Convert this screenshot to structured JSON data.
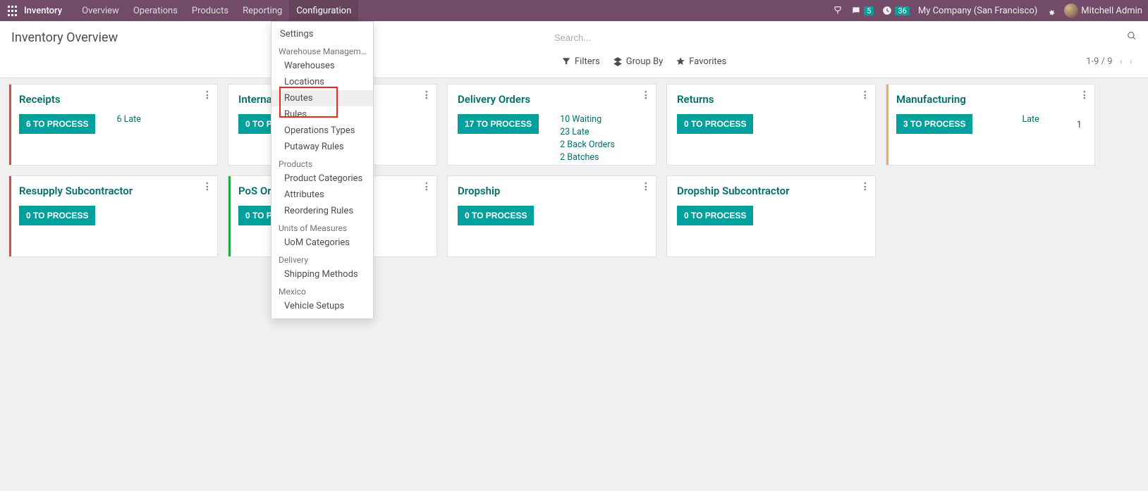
{
  "topbar": {
    "brand": "Inventory",
    "menu": [
      "Overview",
      "Operations",
      "Products",
      "Reporting",
      "Configuration"
    ],
    "active_menu_index": 4,
    "messages_badge": "5",
    "activities_badge": "36",
    "company": "My Company (San Francisco)",
    "user": "Mitchell Admin"
  },
  "control_panel": {
    "title": "Inventory Overview",
    "search_placeholder": "Search...",
    "filters_label": "Filters",
    "groupby_label": "Group By",
    "favorites_label": "Favorites",
    "pager_text": "1-9 / 9"
  },
  "dropdown": {
    "items": [
      {
        "type": "item",
        "label": "Settings"
      },
      {
        "type": "header",
        "label": "Warehouse Management"
      },
      {
        "type": "item",
        "label": "Warehouses",
        "indent": true
      },
      {
        "type": "item",
        "label": "Locations",
        "indent": true
      },
      {
        "type": "item",
        "label": "Routes",
        "indent": true,
        "hover": true
      },
      {
        "type": "item",
        "label": "Rules",
        "indent": true
      },
      {
        "type": "item",
        "label": "Operations Types",
        "indent": true
      },
      {
        "type": "item",
        "label": "Putaway Rules",
        "indent": true
      },
      {
        "type": "header",
        "label": "Products"
      },
      {
        "type": "item",
        "label": "Product Categories",
        "indent": true
      },
      {
        "type": "item",
        "label": "Attributes",
        "indent": true
      },
      {
        "type": "item",
        "label": "Reordering Rules",
        "indent": true
      },
      {
        "type": "header",
        "label": "Units of Measures"
      },
      {
        "type": "item",
        "label": "UoM Categories",
        "indent": true
      },
      {
        "type": "header",
        "label": "Delivery"
      },
      {
        "type": "item",
        "label": "Shipping Methods",
        "indent": true
      },
      {
        "type": "header",
        "label": "Mexico"
      },
      {
        "type": "item",
        "label": "Vehicle Setups",
        "indent": true
      }
    ]
  },
  "cards": [
    {
      "title": "Receipts",
      "button": "6 TO PROCESS",
      "stats": [
        {
          "label": "6 Late"
        }
      ],
      "stripe": "#e24943"
    },
    {
      "title": "Internal Transfers",
      "button": "0 TO PROCESS",
      "stats": [],
      "stripe": ""
    },
    {
      "title": "Delivery Orders",
      "button": "17 TO PROCESS",
      "stats": [
        {
          "label": "10 Waiting"
        },
        {
          "label": "23 Late"
        },
        {
          "label": "2 Back Orders"
        },
        {
          "label": "2 Batches"
        }
      ],
      "stripe": ""
    },
    {
      "title": "Returns",
      "button": "0 TO PROCESS",
      "stats": [],
      "stripe": ""
    },
    {
      "title": "Manufacturing",
      "button": "3 TO PROCESS",
      "late_label": "Late",
      "late_count": "1",
      "stripe": "#f0ad4e"
    },
    {
      "title": "Resupply Subcontractor",
      "button": "0 TO PROCESS",
      "stats": [],
      "stripe": "#e24943"
    },
    {
      "title": "PoS Orders",
      "button": "0 TO PROCESS",
      "stats": [],
      "stripe": "#28a745"
    },
    {
      "title": "Dropship",
      "button": "0 TO PROCESS",
      "stats": [],
      "stripe": ""
    },
    {
      "title": "Dropship Subcontractor",
      "button": "0 TO PROCESS",
      "stats": [],
      "stripe": ""
    }
  ]
}
